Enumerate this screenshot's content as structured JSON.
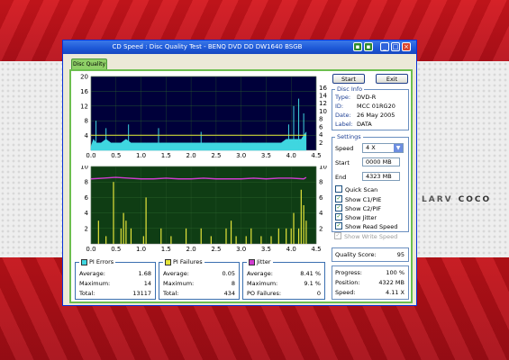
{
  "window": {
    "title": "CD Speed : Disc Quality Test - BENQ    DVD DD DW1640    BSGB",
    "tab": "Disc Quality"
  },
  "wallpaper": {
    "text_left": "LARV",
    "text_right": "COCO"
  },
  "buttons": {
    "start": "Start",
    "exit": "Exit"
  },
  "disc_info": {
    "title": "Disc Info",
    "rows": [
      {
        "key": "Type:",
        "value": "DVD-R"
      },
      {
        "key": "ID:",
        "value": "MCC 01RG20"
      },
      {
        "key": "Date:",
        "value": "26 May 2005"
      },
      {
        "key": "Label:",
        "value": "DATA"
      }
    ]
  },
  "settings": {
    "title": "Settings",
    "speed_label": "Speed",
    "speed_value": "4 X",
    "start_label": "Start",
    "start_value": "0000 MB",
    "end_label": "End",
    "end_value": "4323 MB",
    "checkboxes": [
      {
        "label": "Quick Scan",
        "checked": false,
        "disabled": false
      },
      {
        "label": "Show C1/PIE",
        "checked": true,
        "disabled": false
      },
      {
        "label": "Show C2/PIF",
        "checked": true,
        "disabled": false
      },
      {
        "label": "Show Jitter",
        "checked": true,
        "disabled": false
      },
      {
        "label": "Show Read Speed",
        "checked": true,
        "disabled": false
      },
      {
        "label": "Show Write Speed",
        "checked": true,
        "disabled": true
      }
    ]
  },
  "quality": {
    "label": "Quality Score:",
    "value": "95"
  },
  "progress": {
    "rows": [
      {
        "key": "Progress:",
        "value": "100 %"
      },
      {
        "key": "Position:",
        "value": "4322 MB"
      },
      {
        "key": "Speed:",
        "value": "4.11 X"
      }
    ]
  },
  "pi_errors": {
    "title": "PI Errors",
    "color": "#3fd6e0",
    "rows": [
      {
        "key": "Average:",
        "value": "1.68"
      },
      {
        "key": "Maximum:",
        "value": "14"
      },
      {
        "key": "Total:",
        "value": "13117"
      }
    ]
  },
  "pi_failures": {
    "title": "PI Failures",
    "color": "#e4e43a",
    "rows": [
      {
        "key": "Average:",
        "value": "0.05"
      },
      {
        "key": "Maximum:",
        "value": "8"
      },
      {
        "key": "Total:",
        "value": "434"
      }
    ]
  },
  "jitter": {
    "title": "Jitter",
    "color": "#d13cd1",
    "rows": [
      {
        "key": "Average:",
        "value": "8.41 %"
      },
      {
        "key": "Maximum:",
        "value": "9.1 %"
      },
      {
        "key": "PO Failures:",
        "value": "0"
      }
    ]
  },
  "chart_data": [
    {
      "type": "area",
      "title": "",
      "x_ticks": [
        "0.0",
        "0.5",
        "1.0",
        "1.5",
        "2.0",
        "2.5",
        "3.0",
        "3.5",
        "4.0",
        "4.5"
      ],
      "y_left_ticks": [
        "20",
        "16",
        "12",
        "8",
        "4"
      ],
      "y_right_ticks": [
        "16",
        "14",
        "12",
        "10",
        "8",
        "6",
        "4",
        "2"
      ],
      "xlim": [
        0,
        4.5
      ],
      "ylim": [
        0,
        20
      ],
      "background": "#00003a",
      "series": [
        {
          "name": "PI Errors",
          "color": "#3fd6e0",
          "x": [
            0.0,
            0.05,
            0.1,
            0.2,
            0.3,
            0.4,
            0.5,
            0.6,
            0.7,
            0.8,
            0.9,
            1.0,
            1.1,
            1.2,
            1.3,
            1.4,
            1.5,
            1.6,
            1.7,
            1.8,
            1.9,
            2.0,
            2.1,
            2.2,
            2.3,
            2.4,
            2.5,
            2.6,
            2.7,
            2.8,
            2.9,
            3.0,
            3.1,
            3.2,
            3.3,
            3.4,
            3.5,
            3.6,
            3.7,
            3.8,
            3.9,
            4.0,
            4.1,
            4.2,
            4.25,
            4.3
          ],
          "values": [
            1,
            3,
            2,
            2,
            3,
            2,
            2,
            2,
            3,
            2,
            2,
            2,
            2,
            2,
            2,
            2,
            2,
            2,
            2,
            2,
            2,
            2,
            2,
            2,
            2,
            2,
            2,
            2,
            2,
            2,
            2,
            2,
            2,
            2,
            2,
            2,
            2,
            2,
            2,
            2,
            3,
            3,
            3,
            3,
            4,
            5
          ]
        },
        {
          "name": "Read Speed",
          "color": "#e4e43a",
          "x": [
            0.0,
            4.3
          ],
          "values": [
            4.1,
            4.1
          ]
        }
      ],
      "spikes_x": [
        0.1,
        0.3,
        0.75,
        1.35,
        2.2,
        3.95,
        4.05,
        4.15,
        4.25
      ],
      "spikes_y": [
        8,
        6,
        7,
        6,
        5,
        7,
        12,
        14,
        10
      ]
    },
    {
      "type": "bar",
      "title": "",
      "x_ticks": [
        "0.0",
        "0.5",
        "1.0",
        "1.5",
        "2.0",
        "2.5",
        "3.0",
        "3.5",
        "4.0",
        "4.5"
      ],
      "y_left_ticks": [
        "10",
        "8",
        "6",
        "4",
        "2"
      ],
      "y_right_ticks": [
        "10",
        "8",
        "6",
        "4",
        "2"
      ],
      "xlim": [
        0,
        4.5
      ],
      "ylim": [
        0,
        10
      ],
      "background": "#0f3d14",
      "series": [
        {
          "name": "PI Failures",
          "color": "#e4e43a",
          "x": [
            0.15,
            0.3,
            0.45,
            0.6,
            0.65,
            0.7,
            0.8,
            1.05,
            1.1,
            1.4,
            1.6,
            1.9,
            2.2,
            2.4,
            2.7,
            2.8,
            2.9,
            3.1,
            3.2,
            3.4,
            3.6,
            3.75,
            3.9,
            4.0,
            4.05,
            4.15,
            4.2,
            4.25,
            4.3
          ],
          "values": [
            3,
            1,
            8,
            2,
            4,
            3,
            2,
            1,
            6,
            2,
            1,
            2,
            2,
            1,
            2,
            3,
            1,
            1,
            2,
            1,
            1,
            2,
            2,
            2,
            4,
            2,
            7,
            5,
            3
          ]
        },
        {
          "name": "Jitter",
          "color": "#d13cd1",
          "x": [
            0.0,
            0.25,
            0.5,
            0.75,
            1.0,
            1.25,
            1.5,
            1.75,
            2.0,
            2.25,
            2.5,
            2.75,
            3.0,
            3.25,
            3.5,
            3.75,
            4.0,
            4.25,
            4.3
          ],
          "values": [
            8.4,
            8.5,
            8.6,
            8.5,
            8.4,
            8.4,
            8.5,
            8.4,
            8.4,
            8.5,
            8.4,
            8.4,
            8.4,
            8.5,
            8.4,
            8.5,
            8.5,
            8.4,
            8.6
          ]
        }
      ]
    }
  ]
}
